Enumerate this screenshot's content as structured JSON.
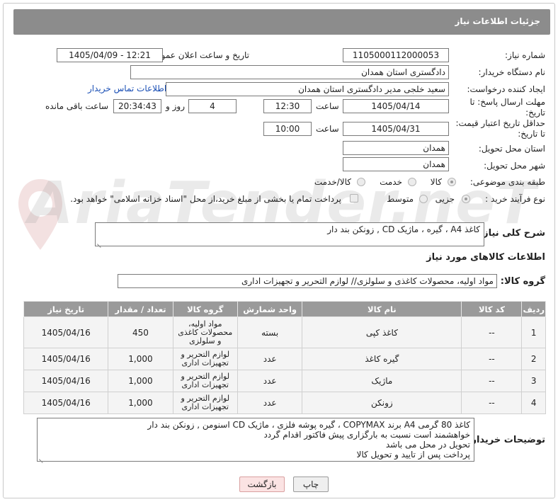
{
  "header": {
    "title": "جزئیات اطلاعات نیاز"
  },
  "watermark": "AriaTender.neT",
  "form": {
    "need_number": {
      "label": "شماره نیاز:",
      "value": "1105000112000053"
    },
    "announce": {
      "label": "تاریخ و ساعت اعلان عمومی:",
      "value": "1405/04/09 - 12:21"
    },
    "buyer": {
      "label": "نام دستگاه خریدار:",
      "value": "دادگستری استان همدان"
    },
    "creator": {
      "label": "ایجاد کننده درخواست:",
      "value": "سعید خلجی مدیر دادگستری استان همدان",
      "contact_link": "اطلاعات تماس خریدار"
    },
    "reply_deadline": {
      "label1": "مهلت ارسال پاسخ: تا",
      "label2": "تاریخ:",
      "date": "1405/04/14",
      "time_label": "ساعت",
      "time": "12:30",
      "days": "4",
      "days_label": "روز و",
      "remaining": "20:34:43",
      "remaining_label": "ساعت باقی مانده"
    },
    "price_validity": {
      "label1": "حداقل تاریخ اعتبار قیمت:",
      "label2": "تا تاریخ:",
      "date": "1405/04/31",
      "time_label": "ساعت",
      "time": "10:00"
    },
    "province": {
      "label": "استان محل تحویل:",
      "value": "همدان"
    },
    "city": {
      "label": "شهر محل تحویل:",
      "value": "همدان"
    },
    "category": {
      "label": "طبقه بندی موضوعی:",
      "options": [
        "کالا",
        "خدمت",
        "کالا/خدمت"
      ],
      "selected": "کالا"
    },
    "process": {
      "label": "نوع فرآیند خرید :",
      "options": [
        "جزیی",
        "متوسط"
      ],
      "selected": "جزیی",
      "payment_note": "پرداخت تمام یا بخشی از مبلغ خرید،از محل \"اسناد خزانه اسلامی\" خواهد بود."
    },
    "description": {
      "label": "شرح کلی نیاز:",
      "value": "کاغذ A4 ، گیره ، ماژیک CD , زونکن بند دار"
    },
    "goods_section_title": "اطلاعات کالاهای مورد نیاز",
    "goods_group": {
      "label": "گروه کالا:",
      "value": "مواد اولیه، محصولات کاغذی و سلولزی// لوازم التحریر و تجهیزات اداری"
    }
  },
  "table": {
    "headers": [
      "ردیف",
      "کد کالا",
      "نام کالا",
      "واحد شمارش",
      "گروه کالا",
      "تعداد / مقدار",
      "تاریخ نیاز"
    ],
    "rows": [
      {
        "row": "1",
        "code": "--",
        "name": "کاغذ کپی",
        "unit": "بسته",
        "group": "مواد اولیه، محصولات کاغذی و سلولزی",
        "qty": "450",
        "date": "1405/04/16"
      },
      {
        "row": "2",
        "code": "--",
        "name": "گیره کاغذ",
        "unit": "عدد",
        "group": "لوازم التحریر و تجهیزات اداری",
        "qty": "1,000",
        "date": "1405/04/16"
      },
      {
        "row": "3",
        "code": "--",
        "name": "ماژیک",
        "unit": "عدد",
        "group": "لوازم التحریر و تجهیزات اداری",
        "qty": "1,000",
        "date": "1405/04/16"
      },
      {
        "row": "4",
        "code": "--",
        "name": "زونکن",
        "unit": "عدد",
        "group": "لوازم التحریر و تجهیزات اداری",
        "qty": "1,000",
        "date": "1405/04/16"
      }
    ]
  },
  "buyer_notes": {
    "label": "توضیحات خریدار:",
    "lines": [
      "کاغذ 80 گرمی A4 برند COPYMAX ، گیره پوشه فلزی ، ماژیک CD اسنومن , زونکن بند دار",
      "خواهشمند است نسبت به بارگزاری پیش فاکتور اقدام گردد",
      "تحویل در محل می باشد",
      "پرداخت پس از تایید و تحویل کالا"
    ]
  },
  "buttons": {
    "print": "چاپ",
    "back": "بازگشت"
  }
}
